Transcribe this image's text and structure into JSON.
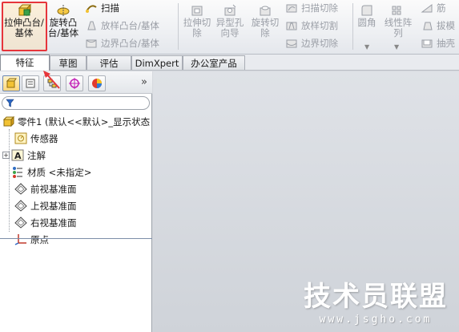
{
  "ribbon": {
    "extrude_boss": "拉伸凸台/基体",
    "revolve_boss": "旋转凸台/基体",
    "sweep": "扫描",
    "loft_boss": "放样凸台/基体",
    "boundary_boss": "边界凸台/基体",
    "extrude_cut": "拉伸切除",
    "hole_wizard": "异型孔向导",
    "revolve_cut": "旋转切除",
    "sweep_cut": "扫描切除",
    "loft_cut": "放样切割",
    "boundary_cut": "边界切除",
    "fillet": "圆角",
    "linear_pattern": "线性阵列",
    "rib": "筋",
    "draft": "拔模",
    "shell": "抽壳"
  },
  "tabs": [
    "特征",
    "草图",
    "评估",
    "DimXpert",
    "办公室产品"
  ],
  "tree": {
    "root": "零件1 (默认<<默认>_显示状态",
    "items": [
      {
        "label": "传感器"
      },
      {
        "label": "注解"
      },
      {
        "label": "材质 <未指定>"
      },
      {
        "label": "前视基准面"
      },
      {
        "label": "上视基准面"
      },
      {
        "label": "右视基准面"
      },
      {
        "label": "原点"
      }
    ],
    "more": "»"
  },
  "watermark": {
    "title": "技术员联盟",
    "url": "www.jsgho.com"
  },
  "colors": {
    "highlight": "#e6353b",
    "canvas": "#d6d9de"
  }
}
